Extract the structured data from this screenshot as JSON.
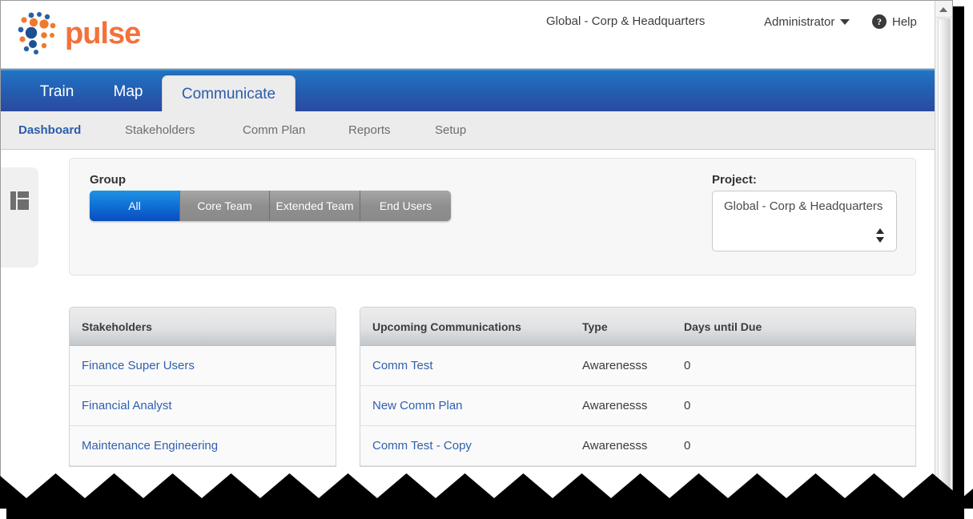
{
  "header": {
    "logo_text": "pulse",
    "logo_icon": "pulse-dots-logo",
    "context": "Global - Corp & Headquarters",
    "user": "Administrator",
    "user_caret_icon": "caret-down-icon",
    "help": "Help",
    "help_icon": "question-circle-icon"
  },
  "nav": {
    "tabs": [
      {
        "label": "Train",
        "active": false
      },
      {
        "label": "Map",
        "active": false
      },
      {
        "label": "Communicate",
        "active": true
      }
    ]
  },
  "subnav": {
    "items": [
      {
        "label": "Dashboard",
        "active": true
      },
      {
        "label": "Stakeholders",
        "active": false
      },
      {
        "label": "Comm Plan",
        "active": false
      },
      {
        "label": "Reports",
        "active": false
      },
      {
        "label": "Setup",
        "active": false
      }
    ]
  },
  "left_rail": {
    "panel_toggle_icon": "panel-layout-icon"
  },
  "filters": {
    "group_label": "Group",
    "group_buttons": [
      {
        "label": "All",
        "active": true
      },
      {
        "label": "Core Team",
        "active": false
      },
      {
        "label": "Extended Team",
        "active": false
      },
      {
        "label": "End Users",
        "active": false
      }
    ],
    "project_label": "Project:",
    "project_value": "Global - Corp & Headquarters",
    "project_spinner_icon": "up-down-spinner-icon"
  },
  "stakeholders_table": {
    "columns": [
      "Stakeholders"
    ],
    "rows": [
      {
        "name": "Finance Super Users"
      },
      {
        "name": "Financial Analyst"
      },
      {
        "name": "Maintenance Engineering"
      }
    ]
  },
  "communications_table": {
    "columns": [
      "Upcoming Communications",
      "Type",
      "Days until Due"
    ],
    "rows": [
      {
        "name": "Comm Test",
        "type": "Awarenesss",
        "days_until_due": "0"
      },
      {
        "name": "New Comm Plan",
        "type": "Awarenesss",
        "days_until_due": "0"
      },
      {
        "name": "Comm Test - Copy",
        "type": "Awarenesss",
        "days_until_due": "0"
      }
    ]
  },
  "scrollbar": {
    "up_arrow_icon": "scroll-up-arrow-icon"
  },
  "colors": {
    "brand_orange": "#f4713a",
    "brand_blue": "#2a5caa",
    "nav_gradient_top": "#2274c4",
    "nav_gradient_bottom": "#2b4a9e",
    "active_button_blue": "#0f71d6",
    "link_blue": "#2f5fb0",
    "panel_gray": "#ececec"
  }
}
